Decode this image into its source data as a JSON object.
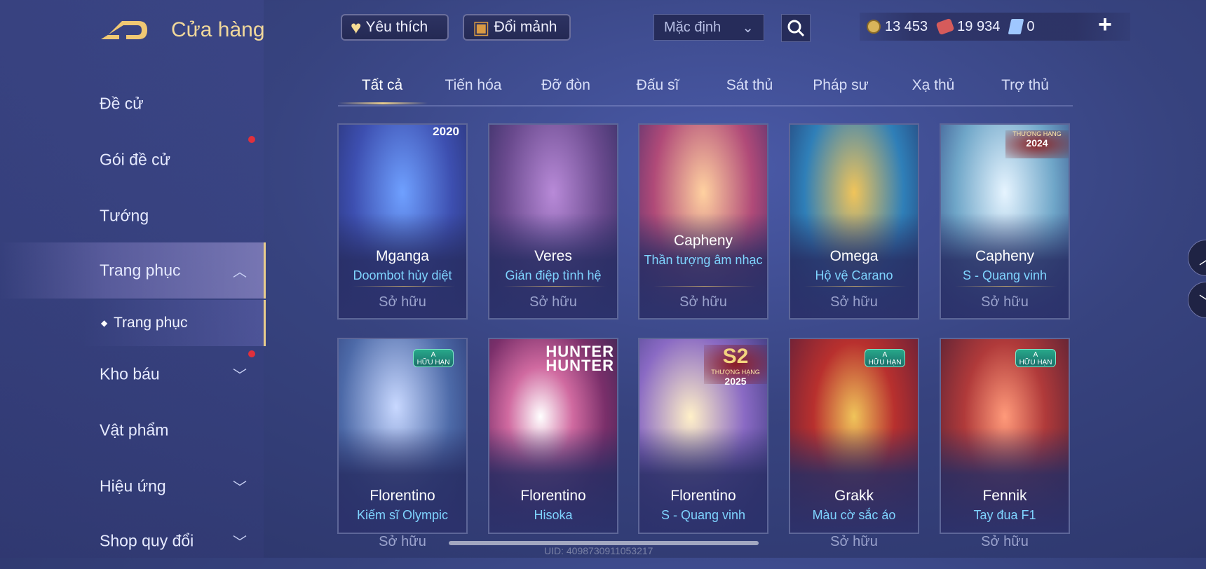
{
  "header": {
    "title": "Cửa hàng",
    "back_icon": "back-arrow-icon",
    "favorite_label": "Yêu thích",
    "exchange_label": "Đổi mảnh",
    "sort_value": "Mặc định",
    "currencies": [
      {
        "name": "gold",
        "value": "13 453"
      },
      {
        "name": "voucher",
        "value": "19 934"
      },
      {
        "name": "gem",
        "value": "0"
      }
    ],
    "plus_label": "+"
  },
  "sidebar": {
    "items": [
      {
        "label": "Đề cử"
      },
      {
        "label": "Gói đề cử"
      },
      {
        "label": "Tướng"
      },
      {
        "label": "Trang phục"
      },
      {
        "label": "Kho báu"
      },
      {
        "label": "Vật phẩm"
      },
      {
        "label": "Hiệu ứng"
      },
      {
        "label": "Shop quy đổi"
      }
    ],
    "sub_item": {
      "label": "Trang phục"
    }
  },
  "tabs": [
    "Tất cả",
    "Tiến hóa",
    "Đỡ đòn",
    "Đấu sĩ",
    "Sát thủ",
    "Pháp sư",
    "Xạ thủ",
    "Trợ thủ"
  ],
  "cards": [
    {
      "hero": "Mganga",
      "skin": "Doombot hủy diệt",
      "status": "Sở hữu",
      "badge": "2020",
      "color": "#3d4fb0"
    },
    {
      "hero": "Veres",
      "skin": "Gián điệp tình hệ",
      "status": "Sở hữu",
      "badge": "",
      "color": "#6a4a8e"
    },
    {
      "hero": "Capheny",
      "skin": "Thần tượng âm nhạc",
      "status": "Sở hữu",
      "badge": "",
      "color": "#b04a78"
    },
    {
      "hero": "Omega",
      "skin": "Hộ vệ Carano",
      "status": "Sở hữu",
      "badge": "",
      "color": "#2f7fb8"
    },
    {
      "hero": "Capheny",
      "skin": "S - Quang vinh",
      "status": "Sở hữu",
      "badge": "THƯỢNG HẠNG 2024",
      "color": "#6fa6c8"
    },
    {
      "hero": "Florentino",
      "skin": "Kiếm sĩ Olympic",
      "status": "Sở hữu",
      "badge": "A HỮU HẠN",
      "color": "#4d6aa8"
    },
    {
      "hero": "Florentino",
      "skin": "Hisoka",
      "status": "Sở hữu",
      "badge": "HUNTER",
      "color": "#7a2f6a"
    },
    {
      "hero": "Florentino",
      "skin": "S - Quang vinh",
      "status": "Sở hữu",
      "badge": "S2 THƯỢNG HẠNG 2025",
      "color": "#8a6ac4"
    },
    {
      "hero": "Grakk",
      "skin": "Màu cờ sắc áo",
      "status": "Sở hữu",
      "badge": "A HỮU HẠN",
      "color": "#b8302e"
    },
    {
      "hero": "Fennik",
      "skin": "Tay đua F1",
      "status": "Sở hữu",
      "badge": "A HỮU HẠN",
      "color": "#b03a3a"
    }
  ],
  "badge_parts": {
    "a": "A",
    "limited": "HỮU HẠN",
    "rank": "THƯỢNG HẠNG",
    "season": "S2",
    "y2024": "2024",
    "y2025": "2025",
    "y2020": "2020",
    "hunter1": "HUNTER",
    "hunter2": "HUNTER"
  },
  "footer": {
    "uid": "UID: 4098730911053217"
  }
}
